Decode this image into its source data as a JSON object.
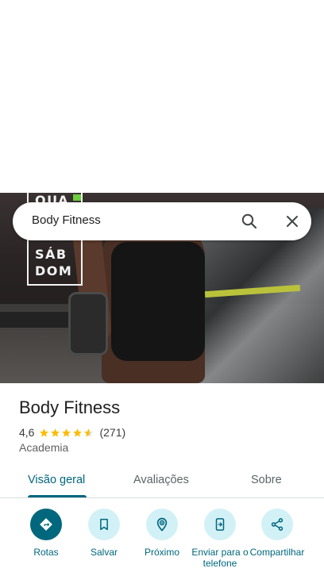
{
  "search": {
    "query": "Body Fitness"
  },
  "hero": {
    "poster_lines": [
      "QUA",
      "SÁB",
      "DOM"
    ]
  },
  "place": {
    "name": "Body Fitness",
    "rating": "4,6",
    "stars": 4.6,
    "review_count": "(271)",
    "category": "Academia"
  },
  "tabs": [
    {
      "label": "Visão geral",
      "active": true
    },
    {
      "label": "Avaliações",
      "active": false
    },
    {
      "label": "Sobre",
      "active": false
    }
  ],
  "actions": [
    {
      "label": "Rotas",
      "icon": "directions-icon"
    },
    {
      "label": "Salvar",
      "icon": "bookmark-icon"
    },
    {
      "label": "Próximo",
      "icon": "nearby-icon"
    },
    {
      "label": "Enviar para o telefone",
      "icon": "send-to-phone-icon"
    },
    {
      "label": "Compartilhar",
      "icon": "share-icon"
    }
  ],
  "colors": {
    "accent": "#00677d",
    "accent_light": "#d2f1f7",
    "star": "#fbbc04"
  }
}
